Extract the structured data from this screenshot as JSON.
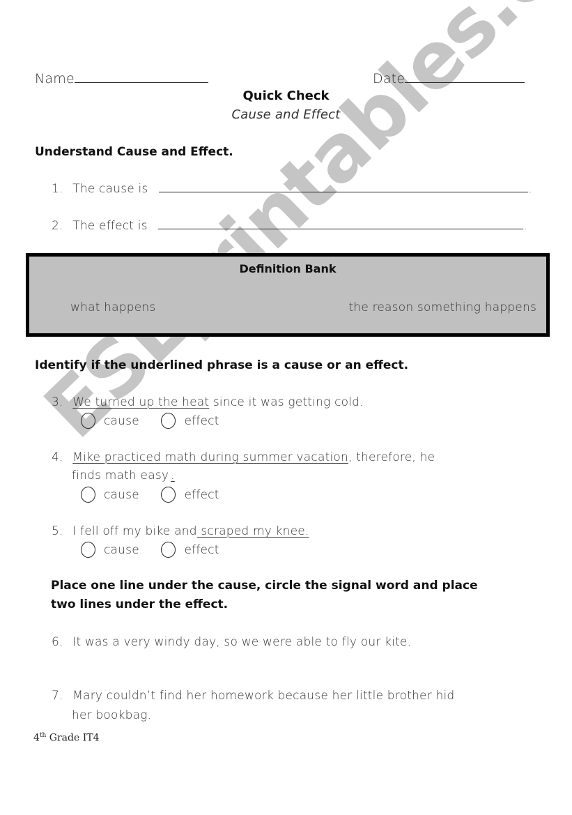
{
  "header": {
    "name_label": "Name",
    "date_label": "Date",
    "title": "Quick Check",
    "subtitle": "Cause and Effect"
  },
  "section1": {
    "heading": "Understand Cause and Effect.",
    "items": [
      {
        "number": "1.",
        "prompt": "The cause is",
        "end": "."
      },
      {
        "number": "2.",
        "prompt": "The effect is",
        "end": "."
      }
    ]
  },
  "definition_bank": {
    "title": "Definition Bank",
    "terms": [
      "what happens",
      "the reason something happens"
    ]
  },
  "section2": {
    "heading": "Identify if the underlined phrase is a cause or an effect.",
    "options": [
      "cause",
      "effect"
    ],
    "items": [
      {
        "number": "3.",
        "underlined": "We turned up the heat",
        "rest": " since it was getting cold."
      },
      {
        "number": "4.",
        "underlined": "Mike practiced math during summer vacation",
        "rest": ", therefore, he",
        "line2": "finds math easy",
        "line2_end": "."
      },
      {
        "number": "5.",
        "plain": "I fell off my bike and",
        "underlined": " scraped my knee."
      }
    ]
  },
  "section3": {
    "heading_line1": "Place one line under the cause, circle the signal word and place",
    "heading_line2": "two lines under the effect.",
    "items": [
      {
        "number": "6.",
        "text": "It was a very windy day, so we were able to fly our kite."
      },
      {
        "number": "7.",
        "text": "Mary couldn’t find her homework because her little brother hid",
        "line2": "her bookbag."
      }
    ]
  },
  "footer": {
    "grade_number": "4",
    "grade_suffix": "th",
    "label": " Grade IT4"
  },
  "watermark": "ESLprintables.com"
}
